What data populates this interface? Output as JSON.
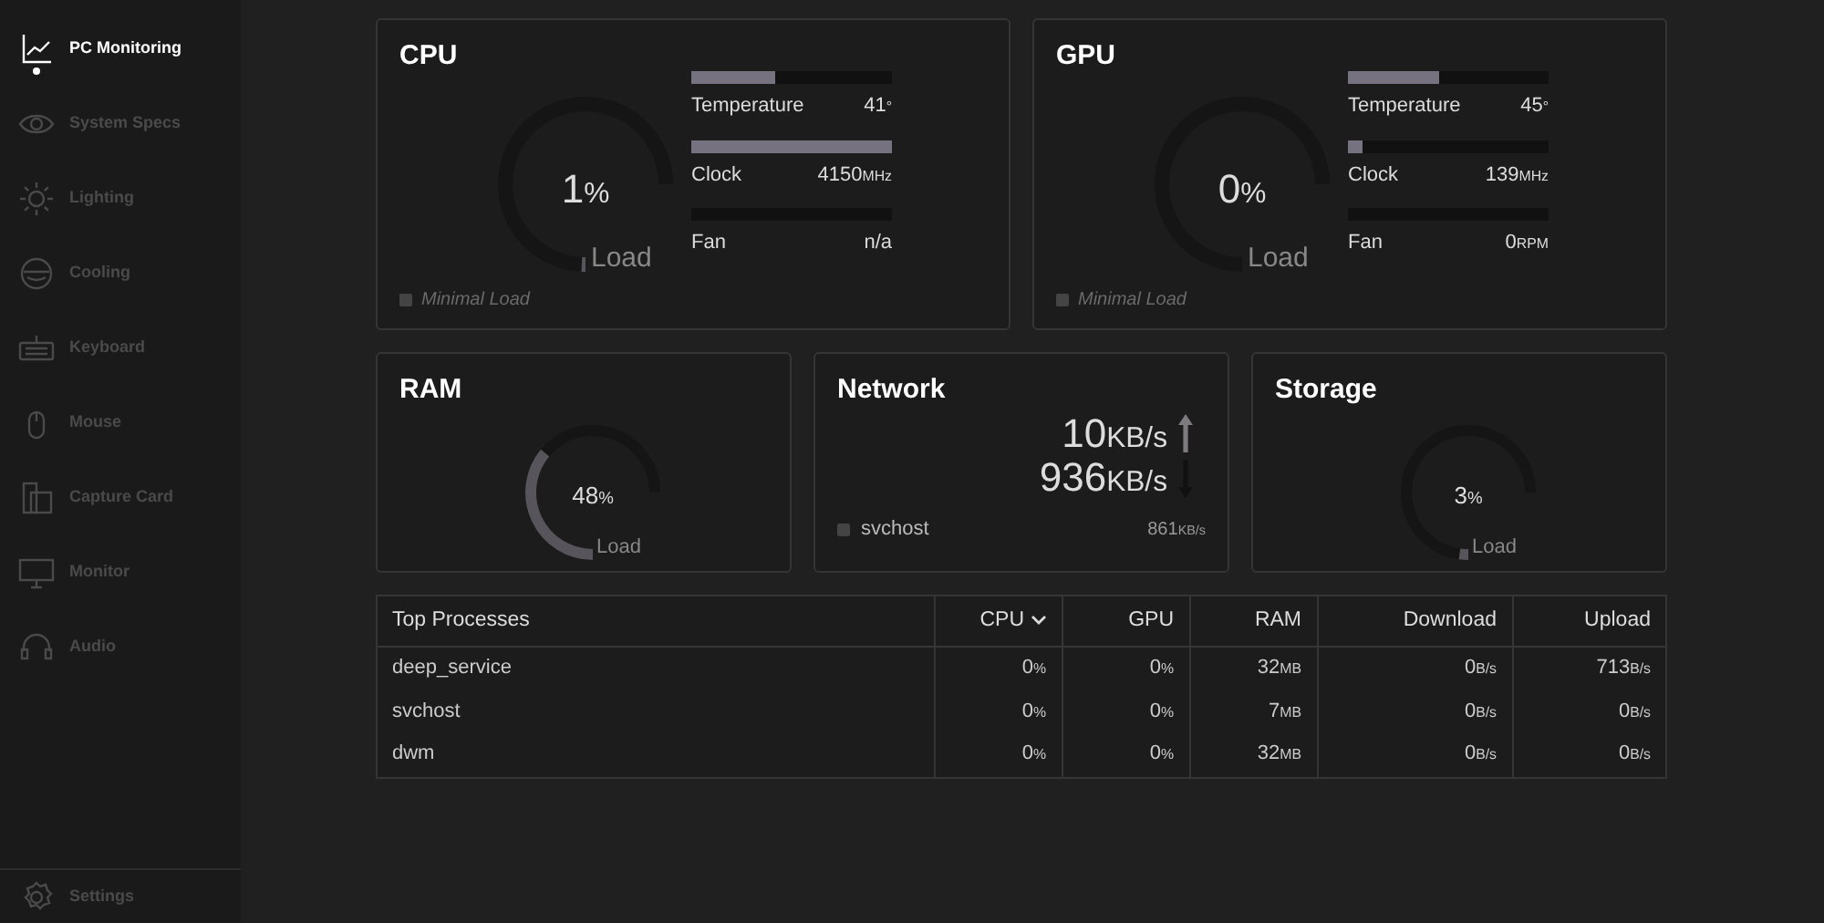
{
  "sidebar": {
    "items": [
      {
        "label": "PC Monitoring",
        "selected": true
      },
      {
        "label": "System Specs",
        "selected": false
      },
      {
        "label": "Lighting",
        "selected": false
      },
      {
        "label": "Cooling",
        "selected": false
      },
      {
        "label": "Keyboard",
        "selected": false
      },
      {
        "label": "Mouse",
        "selected": false
      },
      {
        "label": "Capture Card",
        "selected": false
      },
      {
        "label": "Monitor",
        "selected": false
      },
      {
        "label": "Audio",
        "selected": false
      }
    ],
    "settings": {
      "label": "Settings",
      "selected": false
    }
  },
  "processors": [
    {
      "title": "CPU",
      "load": {
        "value": "1",
        "unit": "%",
        "label": "Load"
      },
      "stats": [
        {
          "label": "Temperature",
          "value": "41",
          "unit": "°",
          "level": 0.42
        },
        {
          "label": "Clock",
          "value": "4150",
          "unit": "MHz",
          "level": 1.0
        },
        {
          "label": "Fan",
          "value": "n/a",
          "level": 0
        }
      ],
      "status": "Minimal Load"
    },
    {
      "title": "GPU",
      "load": {
        "value": "0",
        "unit": "%",
        "label": "Load"
      },
      "stats": [
        {
          "label": "Temperature",
          "value": "45",
          "unit": "°",
          "level": 0.45
        },
        {
          "label": "Clock",
          "value": "139",
          "unit": "MHz",
          "level": 0.07
        },
        {
          "label": "Fan",
          "value": "0",
          "unit": "RPM",
          "level": 0
        }
      ],
      "status": "Minimal Load"
    }
  ],
  "ram": {
    "title": "RAM",
    "value": "48",
    "unit": "%",
    "label": "Load"
  },
  "network": {
    "title": "Network",
    "upload": {
      "value": "10",
      "unit": "KB/s"
    },
    "download": {
      "value": "936",
      "unit": "KB/s"
    },
    "process": "svchost",
    "process_rate": {
      "value": "861",
      "unit": "KB/s"
    }
  },
  "storage": {
    "title": "Storage",
    "value": "3",
    "unit": "%",
    "label": "Load"
  },
  "table": {
    "columns": [
      {
        "label": "Top Processes",
        "sorted": false
      },
      {
        "label": "CPU",
        "sorted": true
      },
      {
        "label": "GPU",
        "sorted": false
      },
      {
        "label": "RAM",
        "sorted": false
      },
      {
        "label": "Download",
        "sorted": false
      },
      {
        "label": "Upload",
        "sorted": false
      }
    ],
    "rows": [
      {
        "cells": [
          {
            "value": "deep_service"
          },
          {
            "value": "0",
            "unit": "%"
          },
          {
            "value": "0",
            "unit": "%"
          },
          {
            "value": "32",
            "unit": "MB"
          },
          {
            "value": "0",
            "unit": "B/s"
          },
          {
            "value": "713",
            "unit": "B/s"
          }
        ]
      },
      {
        "cells": [
          {
            "value": "svchost"
          },
          {
            "value": "0",
            "unit": "%"
          },
          {
            "value": "0",
            "unit": "%"
          },
          {
            "value": "7",
            "unit": "MB"
          },
          {
            "value": "0",
            "unit": "B/s"
          },
          {
            "value": "0",
            "unit": "B/s"
          }
        ]
      },
      {
        "cells": [
          {
            "value": "dwm"
          },
          {
            "value": "0",
            "unit": "%"
          },
          {
            "value": "0",
            "unit": "%"
          },
          {
            "value": "32",
            "unit": "MB"
          },
          {
            "value": "0",
            "unit": "B/s"
          },
          {
            "value": "0",
            "unit": "B/s"
          }
        ]
      }
    ]
  }
}
